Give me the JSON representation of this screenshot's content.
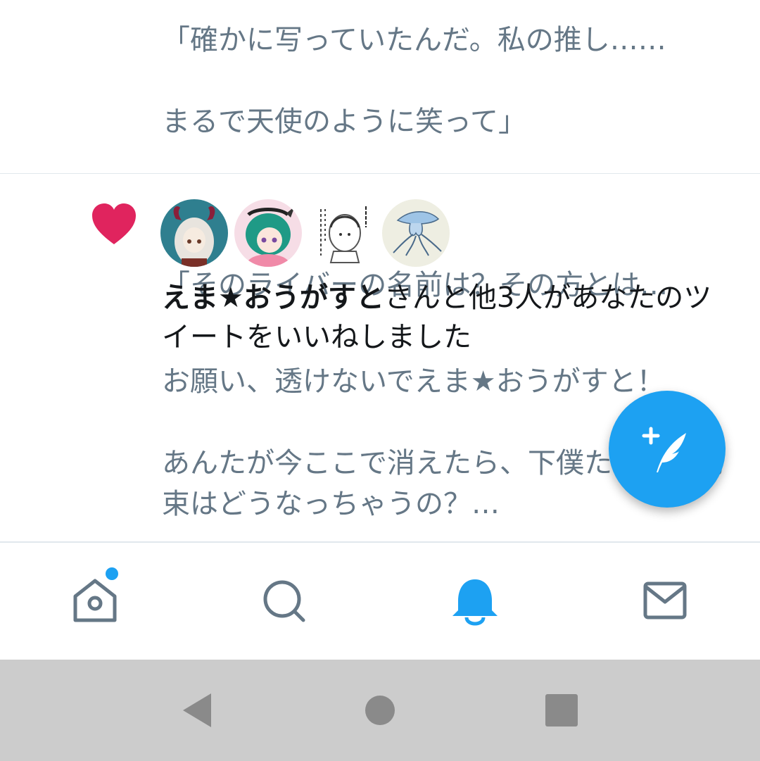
{
  "previous_notification": {
    "text_lines": [
      "「確かに写っていたんだ。私の推し……",
      "まるで天使のように笑って」",
      "",
      "「そのライバーの名前は？その方とは…"
    ]
  },
  "like_notification": {
    "actor_name": "えま★おうがすと",
    "action_text": "さんと他3人があなたのツイートをいいねしました",
    "tweet_snippet": "お願い、透けないでえま★おうがすと！\n\nあんたが今ここで消えたら、下僕たちとの約束はどうなっちゃうの？…",
    "icon": "heart-icon",
    "heart_color": "#e0245e",
    "avatars": [
      "avatar-1",
      "avatar-2",
      "avatar-3",
      "avatar-4"
    ]
  },
  "compose_button": {
    "icon": "compose-tweet-icon",
    "color": "#1da1f2"
  },
  "tabs": [
    {
      "name": "home",
      "icon": "home-icon",
      "has_new_indicator": true
    },
    {
      "name": "search",
      "icon": "search-icon"
    },
    {
      "name": "notifications",
      "icon": "bell-icon",
      "active": true
    },
    {
      "name": "messages",
      "icon": "mail-icon"
    }
  ],
  "system_nav": {
    "buttons": [
      "back-icon",
      "home-circle-icon",
      "recents-icon"
    ]
  },
  "colors": {
    "accent": "#1da1f2",
    "icon_gray": "#657786",
    "like_red": "#e0245e"
  }
}
